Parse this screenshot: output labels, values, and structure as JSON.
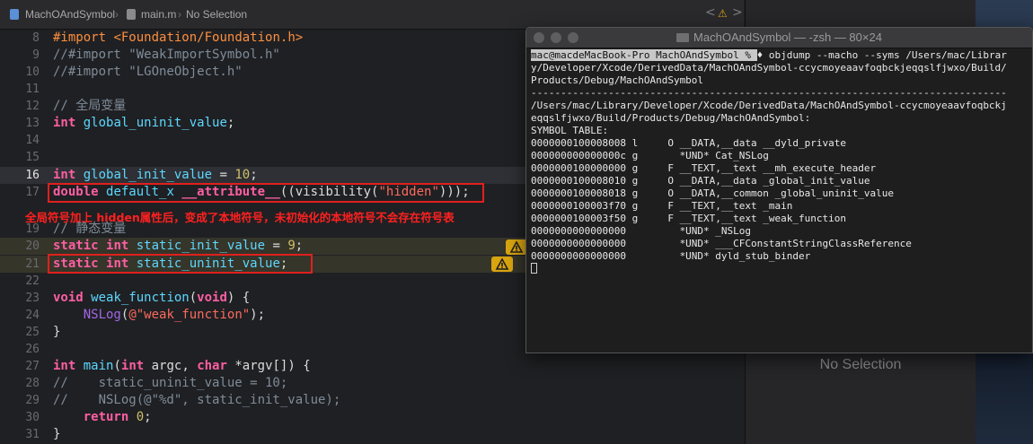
{
  "jumpbar": {
    "project": "MachOAndSymbol",
    "file": "main.m",
    "selection": "No Selection",
    "nav_back": "<",
    "nav_warning": "⚠",
    "nav_forward": ">"
  },
  "editor": {
    "lines": [
      {
        "num": "8"
      },
      {
        "num": "9"
      },
      {
        "num": "10"
      },
      {
        "num": "11"
      },
      {
        "num": "12"
      },
      {
        "num": "13"
      },
      {
        "num": "14"
      },
      {
        "num": "15"
      },
      {
        "num": "16"
      },
      {
        "num": "17"
      },
      {
        "num": "19"
      },
      {
        "num": "20"
      },
      {
        "num": "21"
      },
      {
        "num": "22"
      },
      {
        "num": "23"
      },
      {
        "num": "24"
      },
      {
        "num": "25"
      },
      {
        "num": "26"
      },
      {
        "num": "27"
      },
      {
        "num": "28"
      },
      {
        "num": "29"
      },
      {
        "num": "30"
      },
      {
        "num": "31"
      }
    ],
    "code": {
      "l8_kw": "#import",
      "l8_path": "<Foundation/Foundation.h>",
      "l9": "//#import \"WeakImportSymbol.h\"",
      "l10": "//#import \"LGOneObject.h\"",
      "l12": "// 全局变量",
      "l13_type": "int",
      "l13_name": "global_uninit_value",
      "l13_end": ";",
      "l16_type": "int",
      "l16_name": "global_init_value",
      "l16_eq": " = ",
      "l16_num": "10",
      "l16_end": ";",
      "l17_type": "double",
      "l17_name": "default_x",
      "l17_attr": "__attribute__",
      "l17_mid": "((visibility(",
      "l17_str": "\"hidden\"",
      "l17_end": ")));",
      "l19": "// 静态变量",
      "l20_kw": "static",
      "l20_type": "int",
      "l20_name": "static_init_value",
      "l20_eq": " = ",
      "l20_num": "9",
      "l20_end": ";",
      "l21_kw": "static",
      "l21_type": "int",
      "l21_name": "static_uninit_value",
      "l21_end": ";",
      "l23_type": "void",
      "l23_name": "weak_function",
      "l23_p": "(",
      "l23_void": "void",
      "l23_end": ") {",
      "l24_fn": "NSLog",
      "l24_p": "(",
      "l24_str": "@\"weak_function\"",
      "l24_end": ");",
      "l25": "}",
      "l27_type": "int",
      "l27_name": "main",
      "l27_p": "(",
      "l27_int": "int",
      "l27_argc": " argc, ",
      "l27_char": "char",
      "l27_end": " *argv[]) {",
      "l28": "//    static_uninit_value = 10;",
      "l29": "//    NSLog(@\"%d\", static_init_value);",
      "l30_kw": "return",
      "l30_num": "0",
      "l30_end": ";",
      "l31": "}"
    },
    "annotation": "全局符号加上 hidden属性后，变成了本地符号，未初始化的本地符号不会存在符号表"
  },
  "inspector": {
    "no_selection": "No Selection"
  },
  "terminal": {
    "title": "MachOAndSymbol — -zsh — 80×24",
    "prompt": "mac@macdeMacBook-Pro MachOAndSymbol % ",
    "prompt_glyph": "♦",
    "command": " objdump --macho --syms /Users/mac/Librar",
    "output": [
      "y/Developer/Xcode/DerivedData/MachOAndSymbol-ccycmoyeaavfoqbckjeqqslfjwxo/Build/",
      "Products/Debug/MachOAndSymbol",
      "--------------------------------------------------------------------------------",
      "/Users/mac/Library/Developer/Xcode/DerivedData/MachOAndSymbol-ccycmoyeaavfoqbckj",
      "eqqslfjwxo/Build/Products/Debug/MachOAndSymbol:",
      "SYMBOL TABLE:",
      "0000000100008008 l     O __DATA,__data __dyld_private",
      "000000000000000c g       *UND* Cat_NSLog",
      "0000000100000000 g     F __TEXT,__text __mh_execute_header",
      "0000000100008010 g     O __DATA,__data _global_init_value",
      "0000000100008018 g     O __DATA,__common _global_uninit_value",
      "0000000100003f70 g     F __TEXT,__text _main",
      "0000000100003f50 g     F __TEXT,__text _weak_function",
      "0000000000000000         *UND* _NSLog",
      "0000000000000000         *UND* ___CFConstantStringClassReference",
      "0000000000000000         *UND* dyld_stub_binder"
    ]
  },
  "colors": {
    "editor_bg": "#1f2023",
    "keyword": "#fc5fa3",
    "type": "#5dd8ff",
    "string": "#fc6a5d",
    "number": "#d0bf69",
    "comment": "#7f8c99",
    "annotation_red": "#ff2020",
    "warning_yellow": "#d8a40f"
  }
}
